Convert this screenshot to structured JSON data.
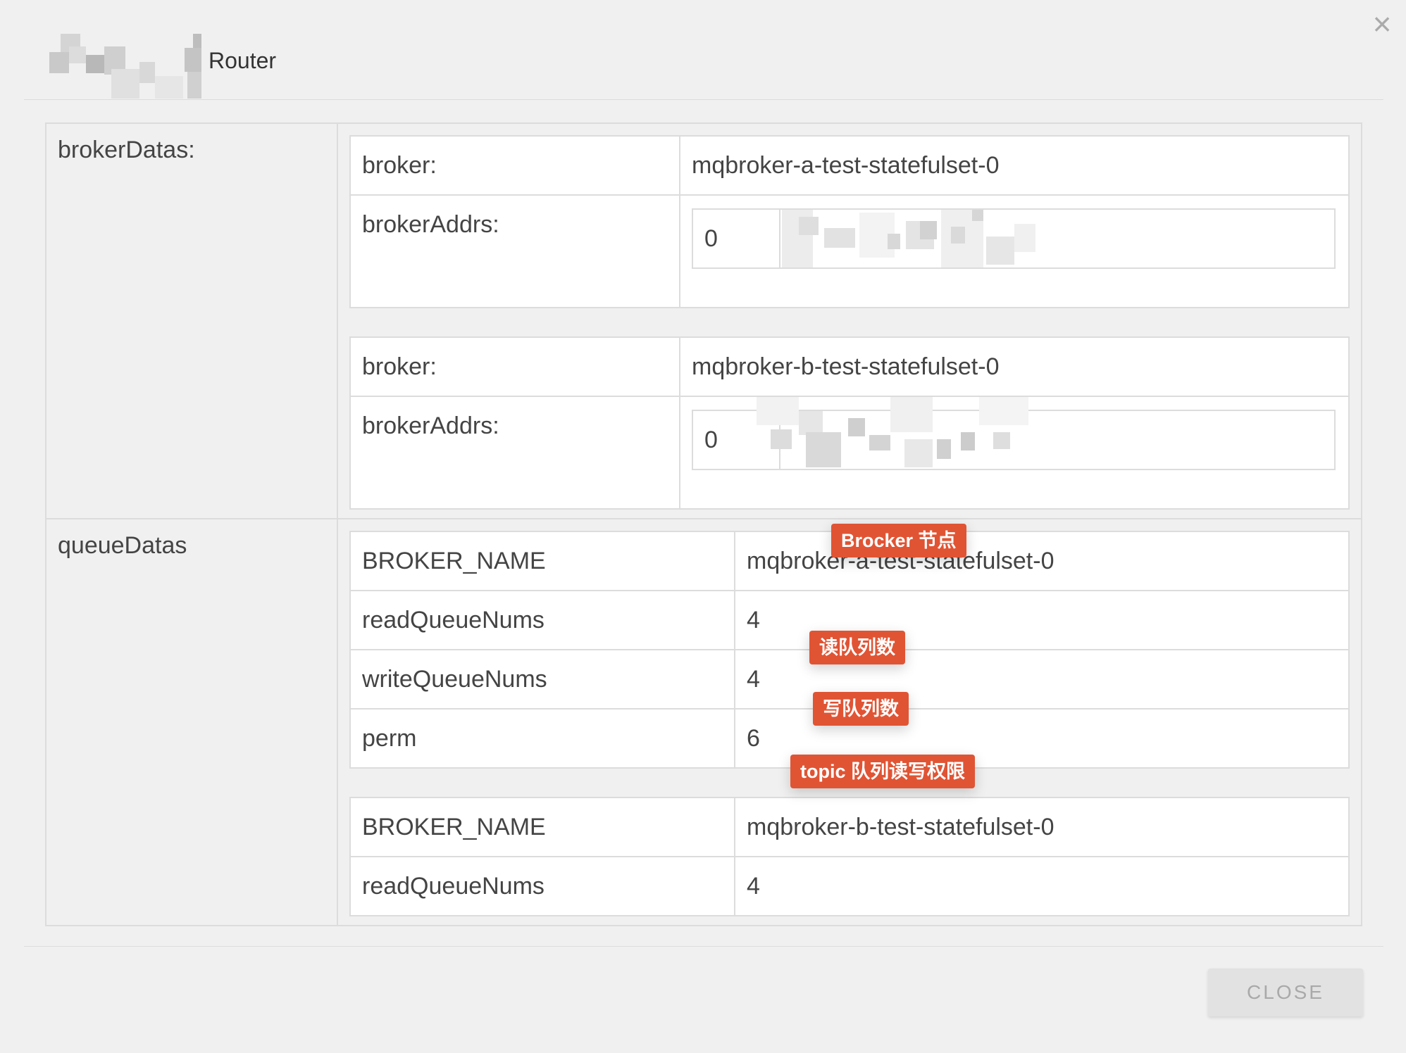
{
  "dialog": {
    "title": "Router",
    "close_icon": "close-icon",
    "close_button_label": "CLOSE"
  },
  "brokerDatas": {
    "label": "brokerDatas:",
    "items": [
      {
        "broker_key": "broker:",
        "broker_value": "mqbroker-a-test-statefulset-0",
        "addrs_key": "brokerAddrs:",
        "addr_index": "0"
      },
      {
        "broker_key": "broker:",
        "broker_value": "mqbroker-b-test-statefulset-0",
        "addrs_key": "brokerAddrs:",
        "addr_index": "0"
      }
    ]
  },
  "queueDatas": {
    "label": "queueDatas",
    "items": [
      {
        "rows": [
          {
            "key": "BROKER_NAME",
            "value": "mqbroker-a-test-statefulset-0"
          },
          {
            "key": "readQueueNums",
            "value": "4"
          },
          {
            "key": "writeQueueNums",
            "value": "4"
          },
          {
            "key": "perm",
            "value": "6"
          }
        ]
      },
      {
        "rows": [
          {
            "key": "BROKER_NAME",
            "value": "mqbroker-b-test-statefulset-0"
          },
          {
            "key": "readQueueNums",
            "value": "4"
          }
        ]
      }
    ]
  },
  "annotations": {
    "broker_node": "Brocker 节点",
    "read_queue": "读队列数",
    "write_queue": "写队列数",
    "perm": "topic 队列读写权限"
  },
  "colors": {
    "annotation_bg": "#e05434",
    "border": "#dcdcdc",
    "background": "#f0f0f0"
  }
}
